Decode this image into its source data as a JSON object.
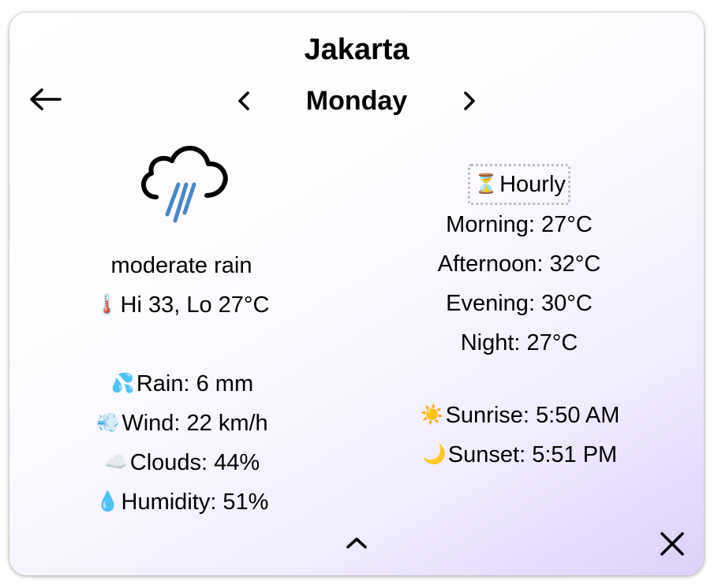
{
  "header": {
    "city": "Jakarta",
    "day": "Monday",
    "icons": {
      "back": "left-arrow-icon",
      "prev": "chevron-left-icon",
      "next": "chevron-right-icon"
    }
  },
  "current": {
    "icon": "rain-cloud-icon",
    "description": "moderate rain",
    "temp_range": {
      "icon": "🌡️",
      "text": "Hi 33, Lo 27°C"
    },
    "details": [
      {
        "key": "rain",
        "icon": "💦",
        "text": "Rain: 6 mm"
      },
      {
        "key": "wind",
        "icon": "💨",
        "text": "Wind: 22 km/h"
      },
      {
        "key": "clouds",
        "icon": "☁️",
        "text": "Clouds: 44%"
      },
      {
        "key": "humidity",
        "icon": "💧",
        "text": "Humidity: 51%"
      }
    ]
  },
  "hourly": {
    "button": {
      "icon": "⏳",
      "label": "Hourly"
    },
    "periods": [
      {
        "key": "morning",
        "text": "Morning: 27°C"
      },
      {
        "key": "afternoon",
        "text": "Afternoon: 32°C"
      },
      {
        "key": "evening",
        "text": "Evening: 30°C"
      },
      {
        "key": "night",
        "text": "Night: 27°C"
      }
    ]
  },
  "sun": {
    "sunrise": {
      "icon": "☀️",
      "text": "Sunrise: 5:50 AM"
    },
    "sunset": {
      "icon": "🌙",
      "text": "Sunset: 5:51 PM"
    }
  },
  "footer": {
    "icons": {
      "collapse": "chevron-up-icon",
      "close": "close-icon"
    }
  },
  "colors": {
    "rain_streaks": "#4a86c5",
    "gradient_end": "#dcd0fb",
    "hourly_border": "#bdbdbd"
  }
}
